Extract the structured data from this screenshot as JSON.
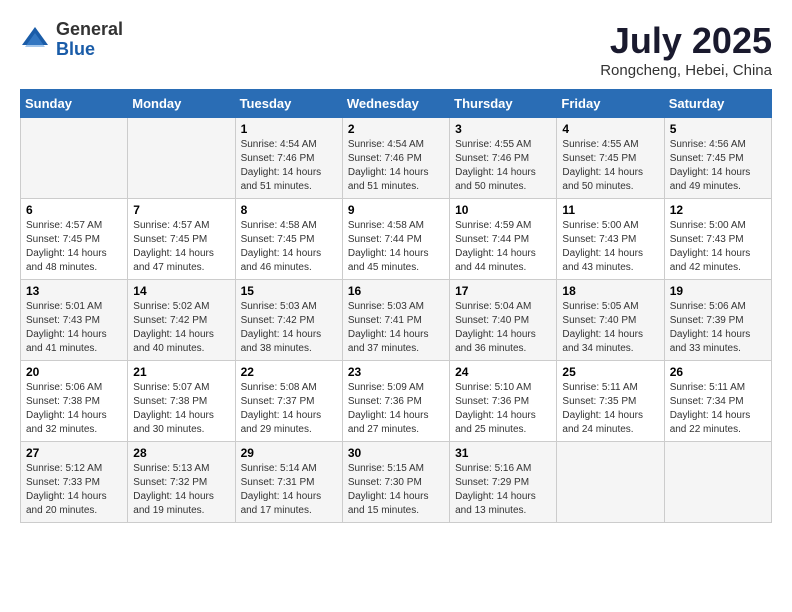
{
  "logo": {
    "general": "General",
    "blue": "Blue"
  },
  "title": "July 2025",
  "subtitle": "Rongcheng, Hebei, China",
  "days_header": [
    "Sunday",
    "Monday",
    "Tuesday",
    "Wednesday",
    "Thursday",
    "Friday",
    "Saturday"
  ],
  "weeks": [
    [
      {
        "day": "",
        "info": ""
      },
      {
        "day": "",
        "info": ""
      },
      {
        "day": "1",
        "info": "Sunrise: 4:54 AM\nSunset: 7:46 PM\nDaylight: 14 hours and 51 minutes."
      },
      {
        "day": "2",
        "info": "Sunrise: 4:54 AM\nSunset: 7:46 PM\nDaylight: 14 hours and 51 minutes."
      },
      {
        "day": "3",
        "info": "Sunrise: 4:55 AM\nSunset: 7:46 PM\nDaylight: 14 hours and 50 minutes."
      },
      {
        "day": "4",
        "info": "Sunrise: 4:55 AM\nSunset: 7:45 PM\nDaylight: 14 hours and 50 minutes."
      },
      {
        "day": "5",
        "info": "Sunrise: 4:56 AM\nSunset: 7:45 PM\nDaylight: 14 hours and 49 minutes."
      }
    ],
    [
      {
        "day": "6",
        "info": "Sunrise: 4:57 AM\nSunset: 7:45 PM\nDaylight: 14 hours and 48 minutes."
      },
      {
        "day": "7",
        "info": "Sunrise: 4:57 AM\nSunset: 7:45 PM\nDaylight: 14 hours and 47 minutes."
      },
      {
        "day": "8",
        "info": "Sunrise: 4:58 AM\nSunset: 7:45 PM\nDaylight: 14 hours and 46 minutes."
      },
      {
        "day": "9",
        "info": "Sunrise: 4:58 AM\nSunset: 7:44 PM\nDaylight: 14 hours and 45 minutes."
      },
      {
        "day": "10",
        "info": "Sunrise: 4:59 AM\nSunset: 7:44 PM\nDaylight: 14 hours and 44 minutes."
      },
      {
        "day": "11",
        "info": "Sunrise: 5:00 AM\nSunset: 7:43 PM\nDaylight: 14 hours and 43 minutes."
      },
      {
        "day": "12",
        "info": "Sunrise: 5:00 AM\nSunset: 7:43 PM\nDaylight: 14 hours and 42 minutes."
      }
    ],
    [
      {
        "day": "13",
        "info": "Sunrise: 5:01 AM\nSunset: 7:43 PM\nDaylight: 14 hours and 41 minutes."
      },
      {
        "day": "14",
        "info": "Sunrise: 5:02 AM\nSunset: 7:42 PM\nDaylight: 14 hours and 40 minutes."
      },
      {
        "day": "15",
        "info": "Sunrise: 5:03 AM\nSunset: 7:42 PM\nDaylight: 14 hours and 38 minutes."
      },
      {
        "day": "16",
        "info": "Sunrise: 5:03 AM\nSunset: 7:41 PM\nDaylight: 14 hours and 37 minutes."
      },
      {
        "day": "17",
        "info": "Sunrise: 5:04 AM\nSunset: 7:40 PM\nDaylight: 14 hours and 36 minutes."
      },
      {
        "day": "18",
        "info": "Sunrise: 5:05 AM\nSunset: 7:40 PM\nDaylight: 14 hours and 34 minutes."
      },
      {
        "day": "19",
        "info": "Sunrise: 5:06 AM\nSunset: 7:39 PM\nDaylight: 14 hours and 33 minutes."
      }
    ],
    [
      {
        "day": "20",
        "info": "Sunrise: 5:06 AM\nSunset: 7:38 PM\nDaylight: 14 hours and 32 minutes."
      },
      {
        "day": "21",
        "info": "Sunrise: 5:07 AM\nSunset: 7:38 PM\nDaylight: 14 hours and 30 minutes."
      },
      {
        "day": "22",
        "info": "Sunrise: 5:08 AM\nSunset: 7:37 PM\nDaylight: 14 hours and 29 minutes."
      },
      {
        "day": "23",
        "info": "Sunrise: 5:09 AM\nSunset: 7:36 PM\nDaylight: 14 hours and 27 minutes."
      },
      {
        "day": "24",
        "info": "Sunrise: 5:10 AM\nSunset: 7:36 PM\nDaylight: 14 hours and 25 minutes."
      },
      {
        "day": "25",
        "info": "Sunrise: 5:11 AM\nSunset: 7:35 PM\nDaylight: 14 hours and 24 minutes."
      },
      {
        "day": "26",
        "info": "Sunrise: 5:11 AM\nSunset: 7:34 PM\nDaylight: 14 hours and 22 minutes."
      }
    ],
    [
      {
        "day": "27",
        "info": "Sunrise: 5:12 AM\nSunset: 7:33 PM\nDaylight: 14 hours and 20 minutes."
      },
      {
        "day": "28",
        "info": "Sunrise: 5:13 AM\nSunset: 7:32 PM\nDaylight: 14 hours and 19 minutes."
      },
      {
        "day": "29",
        "info": "Sunrise: 5:14 AM\nSunset: 7:31 PM\nDaylight: 14 hours and 17 minutes."
      },
      {
        "day": "30",
        "info": "Sunrise: 5:15 AM\nSunset: 7:30 PM\nDaylight: 14 hours and 15 minutes."
      },
      {
        "day": "31",
        "info": "Sunrise: 5:16 AM\nSunset: 7:29 PM\nDaylight: 14 hours and 13 minutes."
      },
      {
        "day": "",
        "info": ""
      },
      {
        "day": "",
        "info": ""
      }
    ]
  ]
}
